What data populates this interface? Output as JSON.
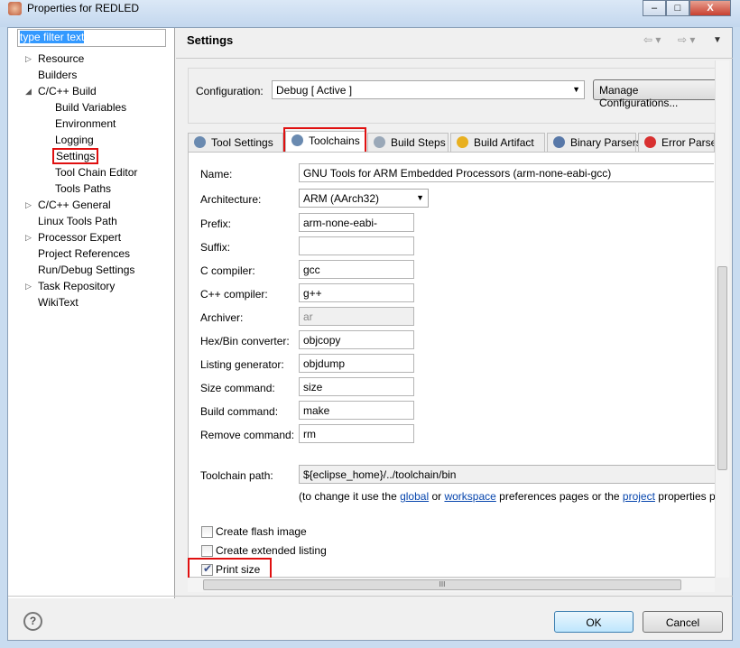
{
  "window": {
    "title": "Properties for REDLED",
    "minimize": "‒",
    "maximize": "□",
    "close": "X"
  },
  "filter": {
    "value": "type filter text"
  },
  "tree": [
    {
      "label": "Resource",
      "level": 0,
      "expandable": true,
      "expanded": false
    },
    {
      "label": "Builders",
      "level": 0,
      "expandable": false
    },
    {
      "label": "C/C++ Build",
      "level": 0,
      "expandable": true,
      "expanded": true
    },
    {
      "label": "Build Variables",
      "level": 1
    },
    {
      "label": "Environment",
      "level": 1
    },
    {
      "label": "Logging",
      "level": 1
    },
    {
      "label": "Settings",
      "level": 1,
      "selected": true
    },
    {
      "label": "Tool Chain Editor",
      "level": 1
    },
    {
      "label": "Tools Paths",
      "level": 1
    },
    {
      "label": "C/C++ General",
      "level": 0,
      "expandable": true,
      "expanded": false
    },
    {
      "label": "Linux Tools Path",
      "level": 0
    },
    {
      "label": "Processor Expert",
      "level": 0,
      "expandable": true,
      "expanded": false
    },
    {
      "label": "Project References",
      "level": 0
    },
    {
      "label": "Run/Debug Settings",
      "level": 0
    },
    {
      "label": "Task Repository",
      "level": 0,
      "expandable": true,
      "expanded": false
    },
    {
      "label": "WikiText",
      "level": 0
    }
  ],
  "header": {
    "title": "Settings",
    "back": "⇦ ▾",
    "forward": "⇨ ▾",
    "menu": "▼"
  },
  "config": {
    "label": "Configuration:",
    "value": "Debug  [ Active ]",
    "manage": "Manage Configurations..."
  },
  "tabs": [
    {
      "label": "Tool Settings",
      "icon": "tool-settings-icon"
    },
    {
      "label": "Toolchains",
      "icon": "toolchains-icon",
      "active": true
    },
    {
      "label": "Build Steps",
      "icon": "build-steps-icon"
    },
    {
      "label": "Build Artifact",
      "icon": "build-artifact-icon"
    },
    {
      "label": "Binary Parsers",
      "icon": "binary-parsers-icon"
    },
    {
      "label": "Error Parse",
      "icon": "error-parsers-icon"
    }
  ],
  "fields": {
    "name": {
      "label": "Name:",
      "value": "GNU Tools for ARM Embedded Processors (arm-none-eabi-gcc)"
    },
    "architecture": {
      "label": "Architecture:",
      "value": "ARM (AArch32)"
    },
    "prefix": {
      "label": "Prefix:",
      "value": "arm-none-eabi-"
    },
    "suffix": {
      "label": "Suffix:",
      "value": ""
    },
    "c_compiler": {
      "label": "C compiler:",
      "value": "gcc"
    },
    "cpp_compiler": {
      "label": "C++ compiler:",
      "value": "g++"
    },
    "archiver": {
      "label": "Archiver:",
      "value": "ar"
    },
    "hexbin": {
      "label": "Hex/Bin converter:",
      "value": "objcopy"
    },
    "listing": {
      "label": "Listing generator:",
      "value": "objdump"
    },
    "size": {
      "label": "Size command:",
      "value": "size"
    },
    "build": {
      "label": "Build command:",
      "value": "make"
    },
    "remove": {
      "label": "Remove command:",
      "value": "rm"
    },
    "toolchain_path": {
      "label": "Toolchain path:",
      "value": "${eclipse_home}/../toolchain/bin"
    }
  },
  "note": {
    "pre": "(to change it use the ",
    "global": "global",
    "or": " or ",
    "workspace": "workspace",
    "mid": " preferences pages or the ",
    "project": "project",
    "post": " properties pa"
  },
  "checkboxes": [
    {
      "label": "Create flash image",
      "checked": false
    },
    {
      "label": "Create extended listing",
      "checked": false
    },
    {
      "label": "Print size",
      "checked": true
    }
  ],
  "scroll": {
    "grip": "III"
  },
  "footer": {
    "help": "?",
    "ok": "OK",
    "cancel": "Cancel"
  }
}
